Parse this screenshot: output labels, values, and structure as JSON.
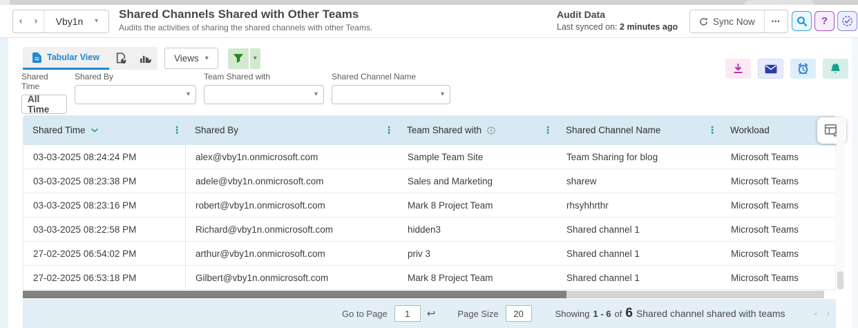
{
  "header": {
    "org": "Vby1n",
    "title": "Shared Channels Shared with Other Teams",
    "subtitle": "Audits the activities of sharing the shared channels with other Teams.",
    "audit_label": "Audit Data",
    "last_synced_prefix": "Last synced on:",
    "last_synced_value": "2 minutes ago",
    "sync_button": "Sync Now"
  },
  "toolbar": {
    "tab_label": "Tabular View",
    "views_button": "Views"
  },
  "filters": {
    "shared_time": {
      "label": "Shared Time",
      "value": "All Time"
    },
    "shared_by": {
      "label": "Shared By",
      "value": ""
    },
    "team_shared_with": {
      "label": "Team Shared with",
      "value": ""
    },
    "shared_channel_name": {
      "label": "Shared Channel Name",
      "value": ""
    }
  },
  "table": {
    "columns": [
      "Shared Time",
      "Shared By",
      "Team Shared with",
      "Shared Channel Name",
      "Workload"
    ],
    "rows": [
      [
        "03-03-2025 08:24:24 PM",
        "alex@vby1n.onmicrosoft.com",
        "Sample Team Site",
        "Team Sharing for blog",
        "Microsoft Teams"
      ],
      [
        "03-03-2025 08:23:38 PM",
        "adele@vby1n.onmicrosoft.com",
        "Sales and Marketing",
        "sharew",
        "Microsoft Teams"
      ],
      [
        "03-03-2025 08:23:16 PM",
        "robert@vby1n.onmicrosoft.com",
        "Mark 8 Project Team",
        "rhsyhhrthr",
        "Microsoft Teams"
      ],
      [
        "03-03-2025 08:22:58 PM",
        "Richard@vby1n.onmicrosoft.com",
        "hidden3",
        "Shared channel 1",
        "Microsoft Teams"
      ],
      [
        "27-02-2025 06:54:02 PM",
        "arthur@vby1n.onmicrosoft.com",
        "priv 3",
        "Shared channel 1",
        "Microsoft Teams"
      ],
      [
        "27-02-2025 06:53:18 PM",
        "Gilbert@vby1n.onmicrosoft.com",
        "Mark 8 Project Team",
        "Shared channel 1",
        "Microsoft Teams"
      ]
    ]
  },
  "pagination": {
    "goto_label": "Go to Page",
    "goto_value": "1",
    "page_size_label": "Page Size",
    "page_size_value": "20",
    "showing_prefix": "Showing",
    "showing_range": "1 - 6",
    "showing_of": "of",
    "showing_total": "6",
    "showing_suffix": "Shared channel shared with teams"
  },
  "icons": {
    "caret": "▾",
    "kebab": "⋮",
    "back": "‹",
    "forward": "›",
    "more": "•••",
    "help": "?",
    "return_arrow": "↩"
  },
  "colors": {
    "accent_teal": "#13a08f",
    "tab_blue": "#1e88d2",
    "table_header_bg": "#d8e9f3",
    "footer_bg": "#e3eff6",
    "filter_green": "#1f8b1f",
    "download_magenta": "#ae28a6",
    "mail_navy": "#2b3cab",
    "alarm_blue": "#3b82d6",
    "bell_teal": "#14a38e",
    "help_purple": "#8e3fc4",
    "search_blue": "#1d8fd0",
    "history_purple": "#6f63d6"
  }
}
